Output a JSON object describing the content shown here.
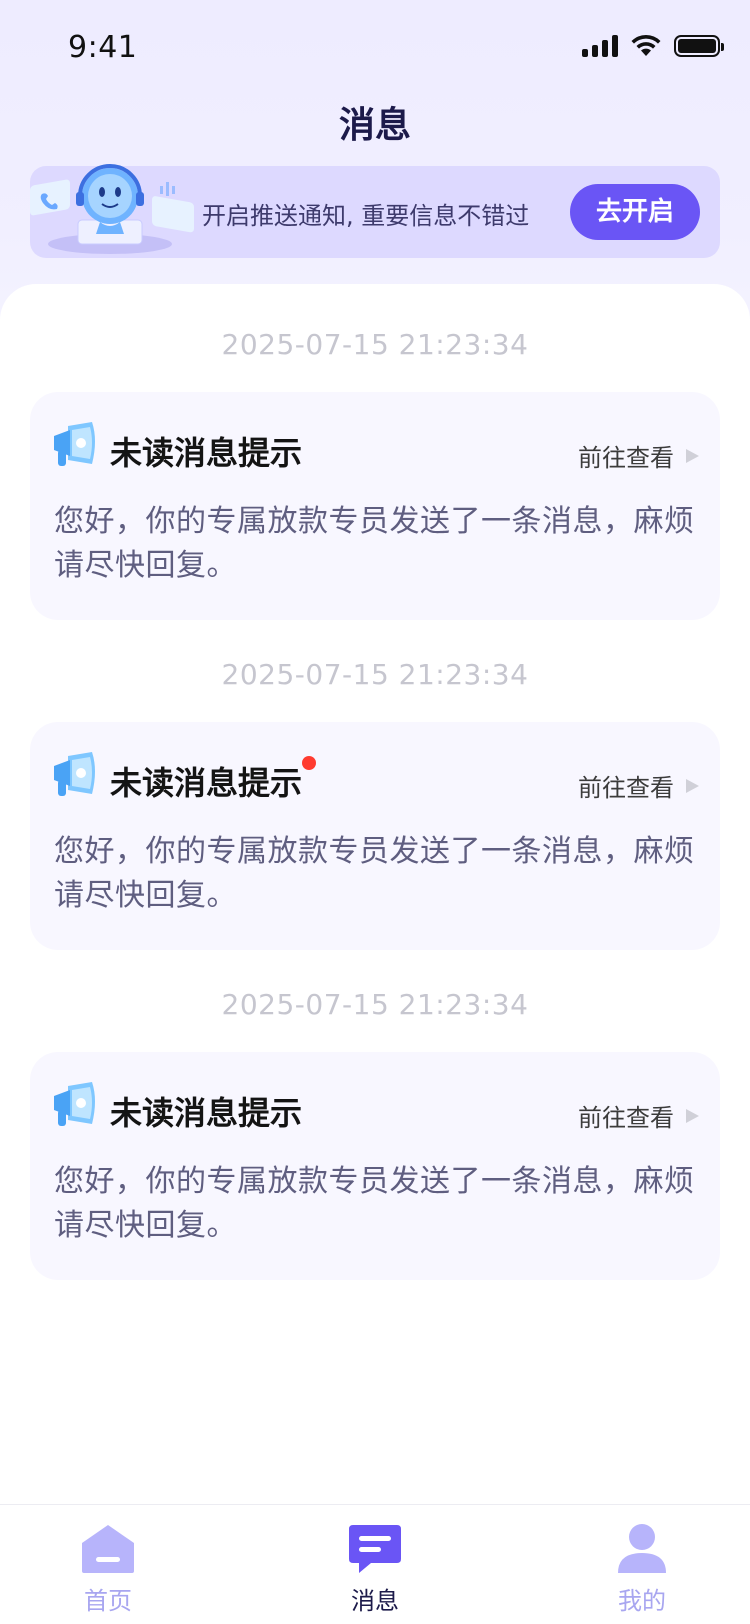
{
  "status_bar": {
    "time": "9:41"
  },
  "header": {
    "title": "消息"
  },
  "banner": {
    "text": "开启推送通知, 重要信息不错过",
    "button_label": "去开启"
  },
  "messages": [
    {
      "timestamp": "2025-07-15 21:23:34",
      "title": "未读消息提示",
      "link_label": "前往查看",
      "body": "您好，你的专属放款专员发送了一条消息，麻烦请尽快回复。",
      "unread": false
    },
    {
      "timestamp": "2025-07-15 21:23:34",
      "title": "未读消息提示",
      "link_label": "前往查看",
      "body": "您好，你的专属放款专员发送了一条消息，麻烦请尽快回复。",
      "unread": true
    },
    {
      "timestamp": "2025-07-15 21:23:34",
      "title": "未读消息提示",
      "link_label": "前往查看",
      "body": "您好，你的专属放款专员发送了一条消息，麻烦请尽快回复。",
      "unread": false
    }
  ],
  "tabbar": {
    "items": [
      {
        "label": "首页",
        "icon": "home-icon",
        "active": false
      },
      {
        "label": "消息",
        "icon": "message-icon",
        "active": true
      },
      {
        "label": "我的",
        "icon": "user-icon",
        "active": false
      }
    ]
  },
  "colors": {
    "accent": "#6a55f5",
    "unread_dot": "#ff3b30",
    "banner_bg": "#ddd9ff"
  }
}
